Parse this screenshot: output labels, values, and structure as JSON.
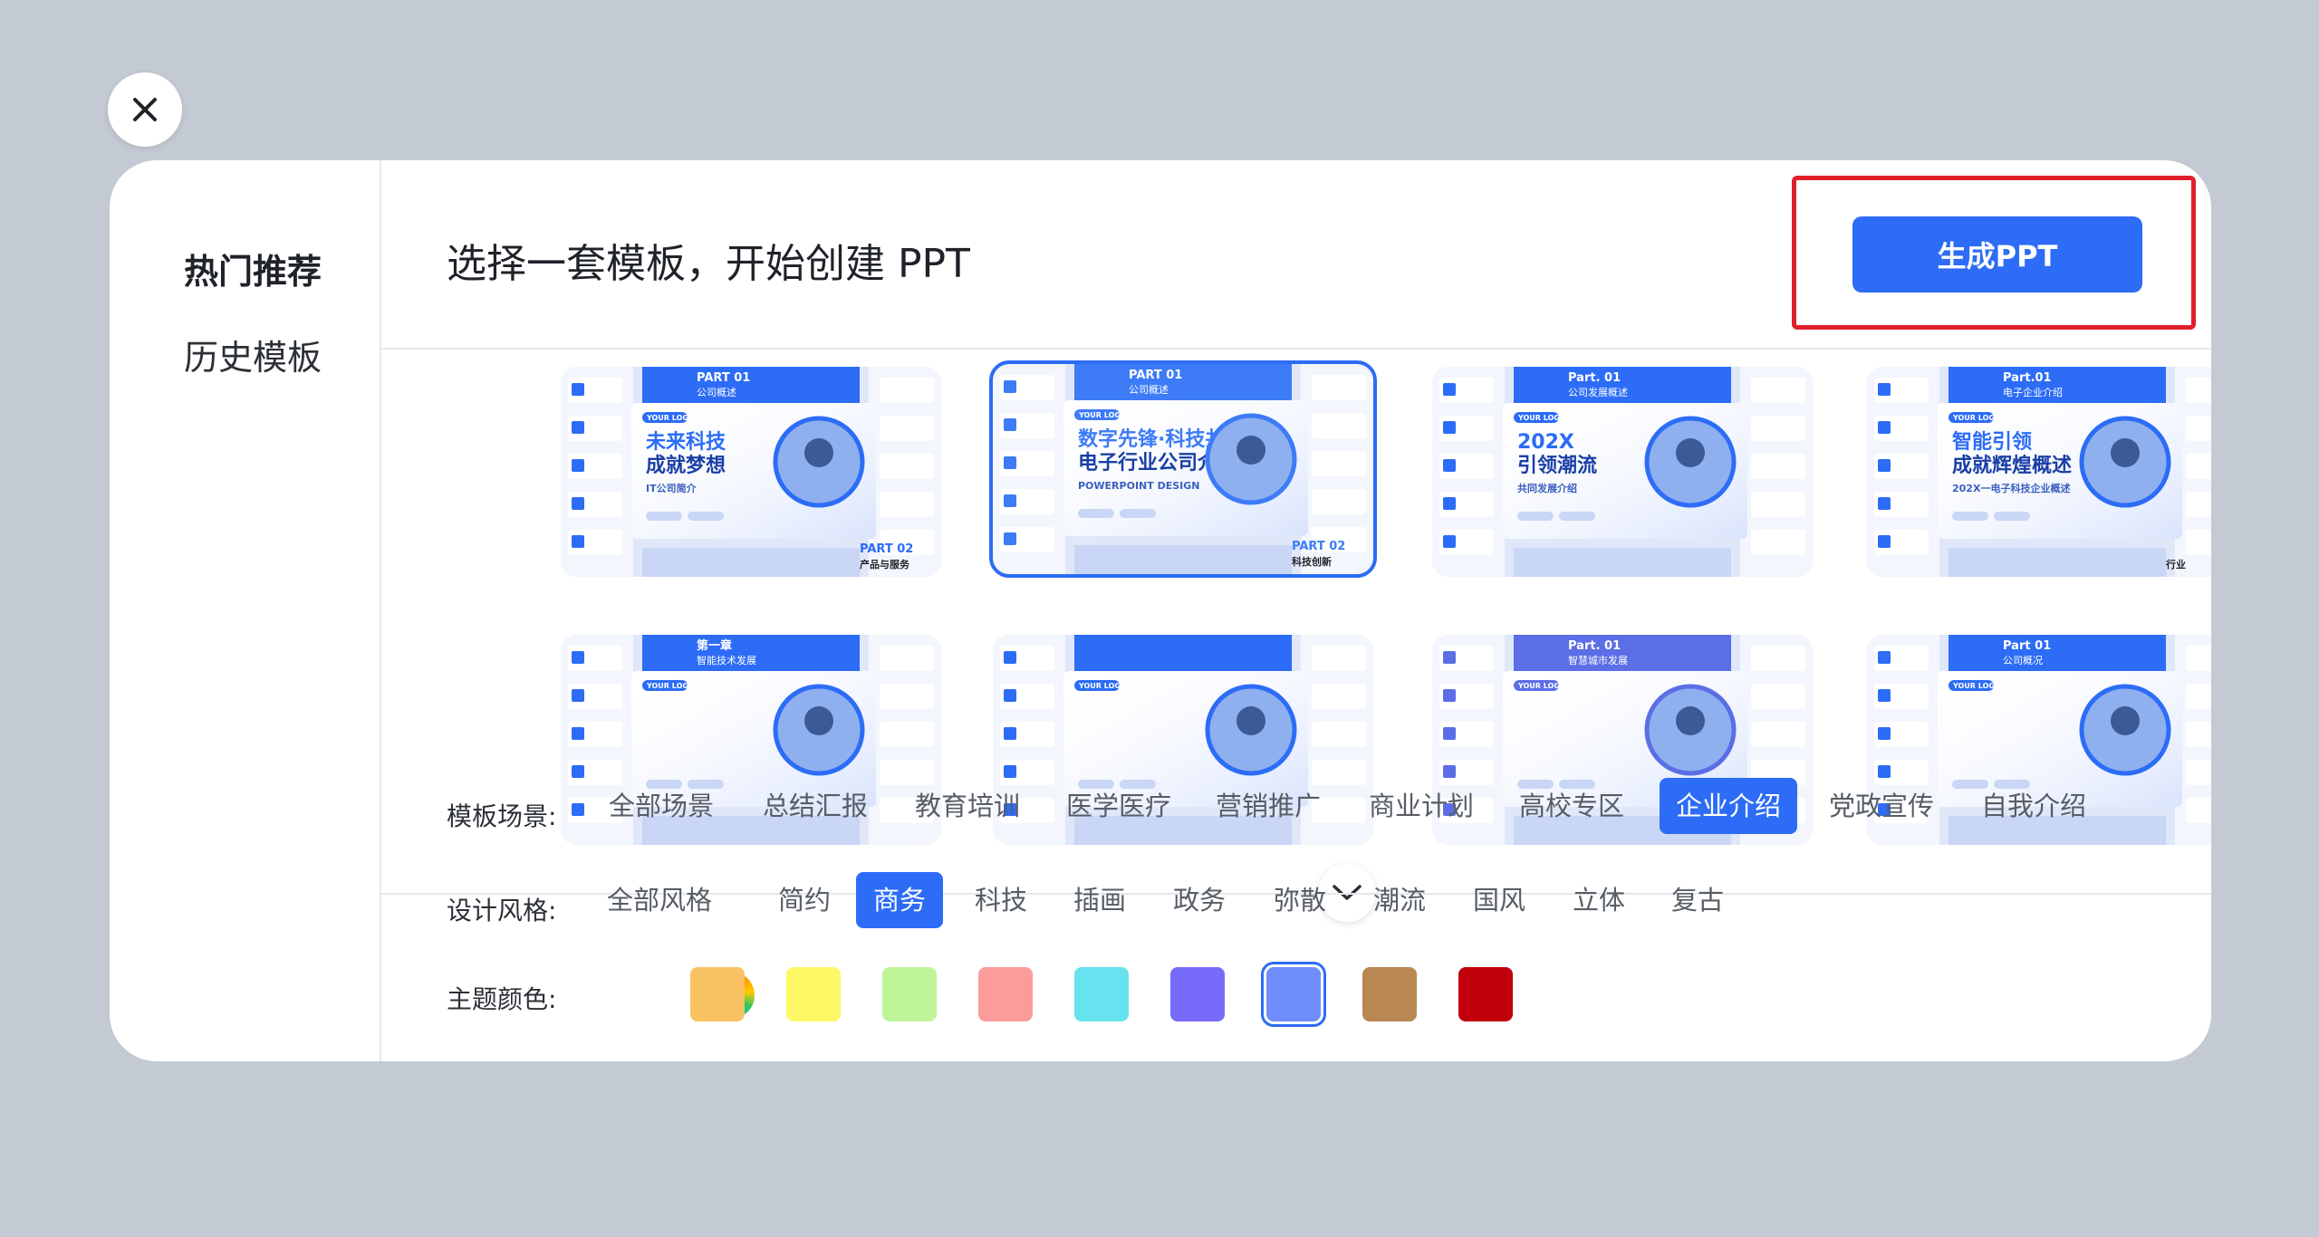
{
  "close": {
    "icon": "close-icon"
  },
  "sidebar": {
    "items": [
      {
        "label": "热门推荐"
      },
      {
        "label": "历史模板"
      }
    ]
  },
  "header": {
    "title": "选择一套模板，开始创建 PPT",
    "generate_label": "生成PPT"
  },
  "templates": [
    {
      "part": "PART 01",
      "section": "公司概述",
      "logo": "YOUR LOGO",
      "line1": "未来科技",
      "line2": "成就梦想",
      "sub": "IT公司简介",
      "part2": "PART 02",
      "section2": "产品与服务",
      "accent": "#2c6cf6"
    },
    {
      "part": "PART 01",
      "section": "公司概述",
      "logo": "YOUR LOGO",
      "line1": "数字先锋·科技共享",
      "line2": "电子行业公司介绍",
      "sub": "POWERPOINT DESIGN",
      "part2": "PART 02",
      "section2": "科技创新",
      "accent": "#3d7bf7"
    },
    {
      "part": "Part. 01",
      "section": "公司发展概述",
      "logo": "YOUR LOGO",
      "line1": "202X",
      "line2": "引领潮流",
      "sub": "共同发展介绍",
      "part2": "",
      "section2": "",
      "accent": "#2c6cf6"
    },
    {
      "part": "Part.01",
      "section": "电子企业介绍",
      "logo": "YOUR LOGO",
      "line1": "智能引领",
      "line2": "成就辉煌概述",
      "sub": "202X一电子科技企业概述",
      "part2": "",
      "section2": "行业",
      "accent": "#2c6cf6"
    },
    {
      "part": "第一章",
      "section": "智能技术发展",
      "logo": "YOUR LOGO",
      "line1": "",
      "line2": "",
      "sub": "",
      "part2": "",
      "section2": "",
      "accent": "#2c6cf6"
    },
    {
      "part": "",
      "section": "",
      "logo": "YOUR LOGO",
      "line1": "",
      "line2": "",
      "sub": "",
      "part2": "",
      "section2": "",
      "accent": "#2c6cf6"
    },
    {
      "part": "Part. 01",
      "section": "智慧城市发展",
      "logo": "YOUR LOGO",
      "line1": "",
      "line2": "",
      "sub": "",
      "part2": "",
      "section2": "",
      "accent": "#5b6ee6"
    },
    {
      "part": "Part 01",
      "section": "公司概况",
      "logo": "YOUR LOGO",
      "line1": "",
      "line2": "",
      "sub": "",
      "part2": "",
      "section2": "",
      "accent": "#2c6cf6"
    }
  ],
  "filters": {
    "scene_label": "模板场景:",
    "scenes": [
      "全部场景",
      "总结汇报",
      "教育培训",
      "医学医疗",
      "营销推广",
      "商业计划",
      "高校专区",
      "企业介绍",
      "党政宣传",
      "自我介绍"
    ],
    "scene_active": "企业介绍",
    "style_label": "设计风格:",
    "styles": [
      "全部风格",
      "简约",
      "商务",
      "科技",
      "插画",
      "政务",
      "弥散",
      "潮流",
      "国风",
      "立体",
      "复古"
    ],
    "style_active": "商务",
    "color_label": "主题颜色:",
    "colors": [
      "#f9c262",
      "#fdf865",
      "#bff598",
      "#fb9b9a",
      "#66e3ee",
      "#776af9",
      "#6f8dfb",
      "#b88754",
      "#c2000c"
    ],
    "color_selected": "#6f8dfb"
  }
}
